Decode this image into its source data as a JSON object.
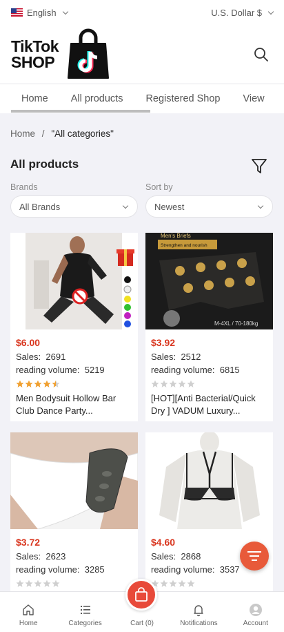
{
  "topbar": {
    "language": "English",
    "currency": "U.S. Dollar $"
  },
  "header": {
    "logo_line1": "TikTok",
    "logo_line2": "SHOP"
  },
  "tabs": [
    {
      "label": "Home"
    },
    {
      "label": "All products"
    },
    {
      "label": "Registered Shop"
    },
    {
      "label": "View"
    }
  ],
  "breadcrumb": {
    "home": "Home",
    "sep": "/",
    "current": "\"All categories\""
  },
  "page_title": "All products",
  "filters": {
    "brands_label": "Brands",
    "brands_value": "All Brands",
    "sort_label": "Sort by",
    "sort_value": "Newest"
  },
  "products": [
    {
      "price": "$6.00",
      "sales_label": "Sales:",
      "sales": "2691",
      "reading_label": "reading volume:",
      "reading": "5219",
      "rating": 4.5,
      "name": "Men Bodysuit Hollow Bar Club Dance Party..."
    },
    {
      "price": "$3.92",
      "sales_label": "Sales:",
      "sales": "2512",
      "reading_label": "reading volume:",
      "reading": "6815",
      "rating": 0,
      "name": "[HOT][Anti Bacterial/Quick Dry ] VADUM Luxury...",
      "img_text_top": "Men's Briefs",
      "img_text_mid": "Strengthen and nourish",
      "img_text_bottom": "M-4XL / 70-180kg"
    },
    {
      "price": "$3.72",
      "sales_label": "Sales:",
      "sales": "2623",
      "reading_label": "reading volume:",
      "reading": "3285",
      "rating": 0,
      "name": ""
    },
    {
      "price": "$4.60",
      "sales_label": "Sales:",
      "sales": "2868",
      "reading_label": "reading volume:",
      "reading": "3537",
      "rating": 0,
      "name": ""
    }
  ],
  "bottom_nav": [
    {
      "label": "Home",
      "icon": "home-icon"
    },
    {
      "label": "Categories",
      "icon": "list-icon"
    },
    {
      "label": "Cart (0)",
      "icon": "cart-icon"
    },
    {
      "label": "Notifications",
      "icon": "bell-icon"
    },
    {
      "label": "Account",
      "icon": "avatar-icon"
    }
  ],
  "colors": {
    "price": "#d9361f",
    "fab": "#e85a3a",
    "cart": "#e84a3a",
    "star_on": "#f0a030",
    "star_off": "#cfcfcf"
  }
}
